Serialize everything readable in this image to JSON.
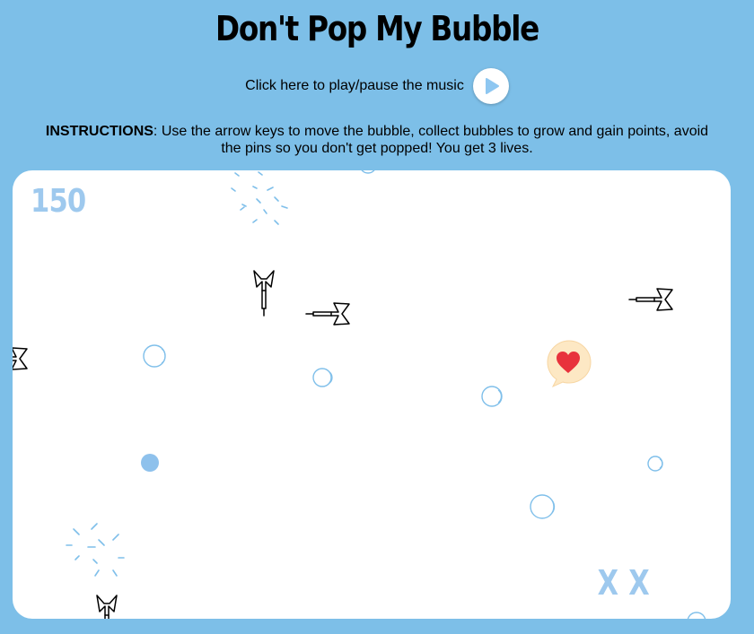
{
  "title": "Don't Pop My Bubble",
  "music": {
    "label": "Click here to play/pause the music",
    "icon": "play-icon"
  },
  "instructions": {
    "label": "INSTRUCTIONS",
    "text": ": Use the arrow keys to move the bubble, collect bubbles to grow and gain points, avoid the pins so you don't get popped! You get 3 lives."
  },
  "game": {
    "score": "150",
    "lives_marks": "XX"
  },
  "colors": {
    "background": "#7dbfe8",
    "bubble": "#7fbfea",
    "score": "#9ec9ee",
    "heart": "#e8323c",
    "heart_bubble": "#fde8c4"
  }
}
